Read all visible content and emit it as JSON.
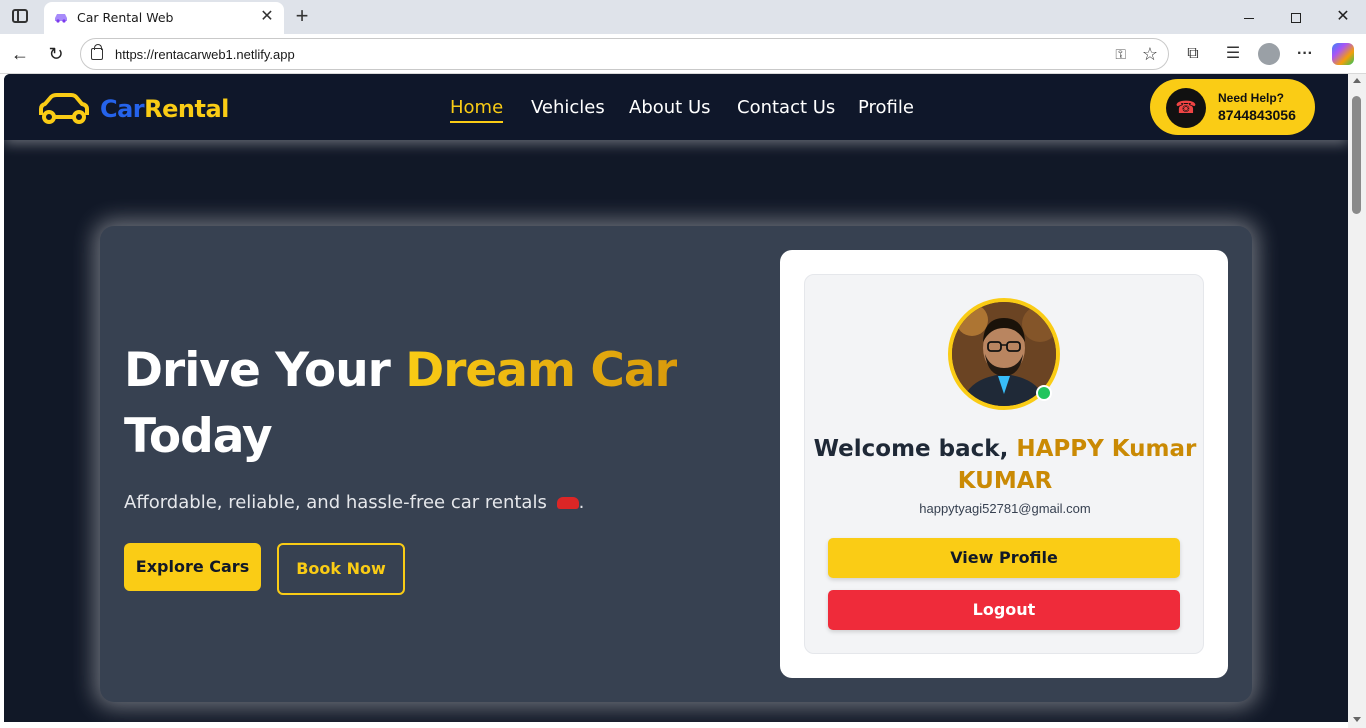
{
  "browser": {
    "tab_title": "Car Rental Web",
    "url": "https://rentacarweb1.netlify.app",
    "icons": [
      "sidebar-toggle-icon",
      "favicon-icon",
      "close-icon",
      "plus-icon",
      "back-arrow-icon",
      "reload-icon",
      "lock-icon",
      "key-icon",
      "star-icon",
      "extensions-icon",
      "favorites-icon",
      "profile-icon",
      "more-icon",
      "copilot-icon",
      "minimize-icon",
      "maximize-icon",
      "close-window-icon"
    ]
  },
  "header": {
    "logo": {
      "part1": "Car",
      "part2": "Rental"
    },
    "nav": [
      {
        "label": "Home",
        "active": true
      },
      {
        "label": "Vehicles",
        "active": false
      },
      {
        "label": "About Us",
        "active": false
      },
      {
        "label": "Contact Us",
        "active": false
      },
      {
        "label": "Profile",
        "active": false
      }
    ],
    "help": {
      "label": "Need Help?",
      "phone": "8744843056"
    }
  },
  "hero": {
    "title_part1": "Drive Your ",
    "title_accent": "Dream Car",
    "title_part2": "Today",
    "subtitle": "Affordable, reliable, and hassle-free car rentals",
    "subtitle_end": ".",
    "primary_button": "Explore Cars",
    "secondary_button": "Book Now"
  },
  "profile": {
    "welcome_prefix": "Welcome back, ",
    "name": "HAPPY Kumar KUMAR",
    "email": "happytyagi52781@gmail.com",
    "view_profile_button": "View Profile",
    "logout_button": "Logout",
    "status": "online"
  },
  "colors": {
    "page_bg": "#111827",
    "card_bg": "#374151",
    "accent": "#facc15",
    "logo_blue": "#2563eb",
    "logout_red": "#ef2b3a"
  }
}
